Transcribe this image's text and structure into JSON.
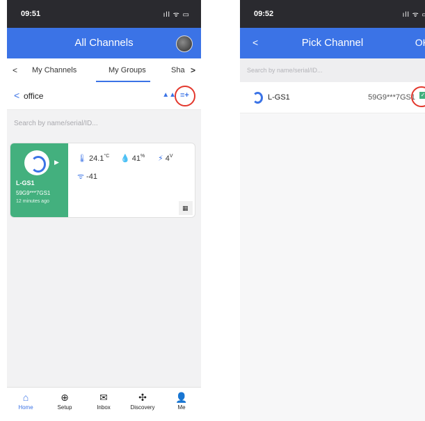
{
  "left": {
    "status_time": "09:51",
    "status_icons": "ıll ᯤ ▭",
    "title": "All Channels",
    "tabs": [
      "My Channels",
      "My Groups",
      "Sha"
    ],
    "tab_prev_icon": "<",
    "tab_next_icon": ">",
    "back_icon": "<",
    "breadcrumb": "office",
    "search_placeholder": "Search by name/serial/ID...",
    "device": {
      "name": "L-GS1",
      "serial": "59G9***7GS1",
      "updated": "12 minutes ago",
      "temperature": "24.1",
      "temperature_unit": "°C",
      "humidity": "41",
      "humidity_unit": "%",
      "voltage": "4",
      "voltage_unit": "V",
      "rssi": "-41"
    },
    "nav": [
      "Home",
      "Setup",
      "Inbox",
      "Discovery",
      "Me"
    ]
  },
  "right": {
    "status_time": "09:52",
    "status_icons": "ıll ᯤ ▭",
    "title": "Pick Channel",
    "back_label": "<",
    "ok_label": "OK",
    "search_placeholder": "Search by name/serial/ID...",
    "channel": {
      "name": "L-GS1",
      "serial": "59G9***7GS1",
      "selected": true
    }
  },
  "colors": {
    "header": "#3b73e6",
    "device_card": "#43b07e",
    "highlight_circle": "#e3372c"
  }
}
